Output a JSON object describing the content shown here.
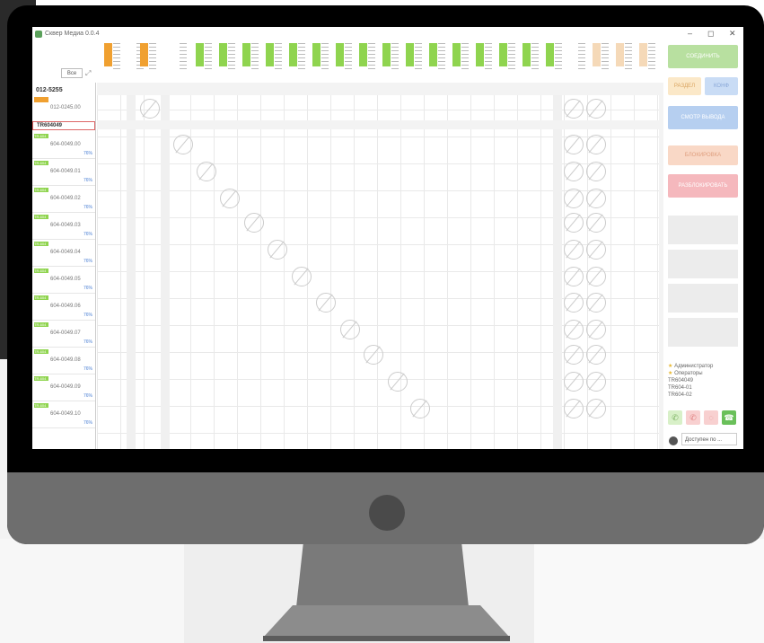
{
  "window": {
    "title": "Сквер Медиа 0.0.4",
    "minimize": "–",
    "maximize": "◻",
    "close": "✕"
  },
  "left": {
    "filter_label": "Все",
    "group1_title": "012-5255",
    "group1_item": "012-0245.00",
    "group2_title": "TR604049",
    "rows": [
      {
        "tag": "TR-604",
        "name": "604-0049.00",
        "pct": "76%"
      },
      {
        "tag": "TR-604",
        "name": "604-0049.01",
        "pct": "76%"
      },
      {
        "tag": "TR-604",
        "name": "604-0049.02",
        "pct": "76%"
      },
      {
        "tag": "TR-604",
        "name": "604-0049.03",
        "pct": "76%"
      },
      {
        "tag": "TR-604",
        "name": "604-0049.04",
        "pct": "76%"
      },
      {
        "tag": "TR-604",
        "name": "604-0049.05",
        "pct": "76%"
      },
      {
        "tag": "TR-604",
        "name": "604-0049.06",
        "pct": "76%"
      },
      {
        "tag": "TR-604",
        "name": "604-0049.07",
        "pct": "76%"
      },
      {
        "tag": "TR-604",
        "name": "604-0049.08",
        "pct": "76%"
      },
      {
        "tag": "TR-604",
        "name": "604-0049.09",
        "pct": "76%"
      },
      {
        "tag": "TR-604",
        "name": "604-0049.10",
        "pct": "76%"
      }
    ]
  },
  "right": {
    "connect": "СОЕДИНИТЬ",
    "split1": "РАЗДЕЛ",
    "split2": "КОНФ",
    "preview": "СМОТР ВЫВОДА",
    "lock": "БЛОКИРОВКА",
    "unlock": "РАЗБЛОКИРОВАТЬ",
    "contacts": [
      "Администратор",
      "Операторы",
      "TR604049",
      "TR604-01",
      "TR604-02"
    ],
    "status": "Доступен по ..."
  },
  "colors": {
    "accent_green": "#8fd44f",
    "accent_orange": "#f0a030",
    "accent_red": "#e88a8a",
    "accent_blue": "#a8c6ee"
  }
}
